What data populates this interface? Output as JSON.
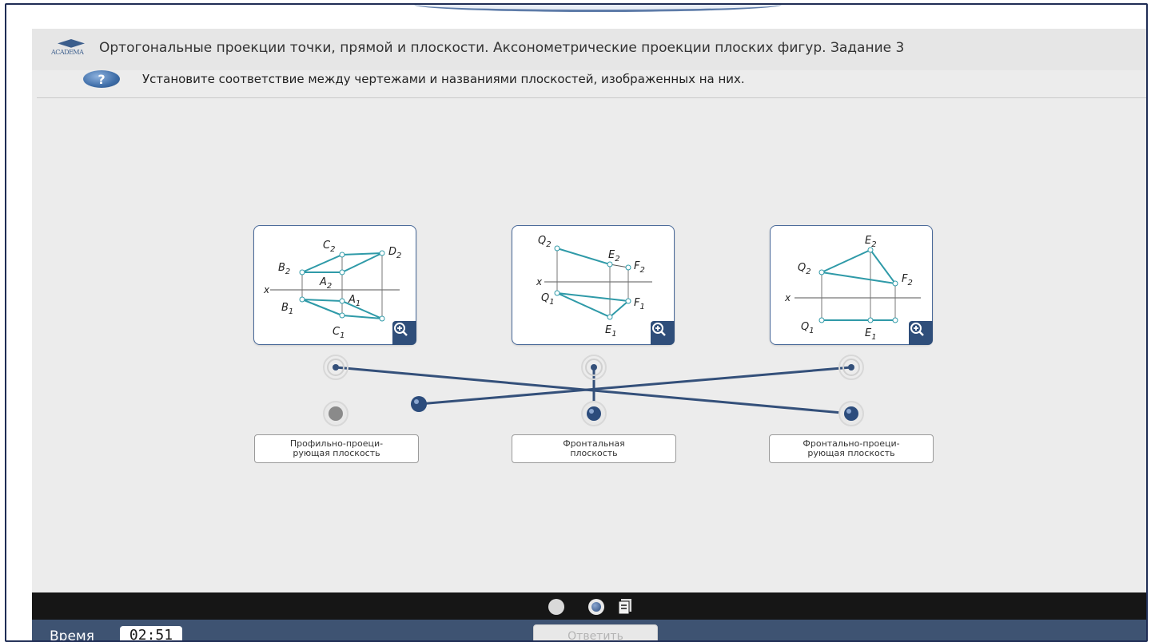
{
  "header": {
    "logo_text": "ACADEMA",
    "title": "Ортогональные проекции точки, прямой и плоскости. Аксонометрические проекции плоских фигур. Задание 3"
  },
  "question": {
    "icon": "question-icon",
    "text": "Установите соответствие между чертежами и названиями плоскостей, изображенных на них."
  },
  "drawings": [
    {
      "x_label": "x",
      "points": {
        "C2": "C2",
        "D2": "D2",
        "B2": "B2",
        "A2": "A2",
        "A1": "A1",
        "B1": "B1",
        "C1": "C1"
      },
      "zoom_icon": "zoom-in-icon"
    },
    {
      "x_label": "x",
      "points": {
        "Q2": "Q2",
        "E2": "E2",
        "F2": "F2",
        "Q1": "Q1",
        "F1": "F1",
        "E1": "E1"
      },
      "zoom_icon": "zoom-in-icon"
    },
    {
      "x_label": "x",
      "points": {
        "E2": "E2",
        "Q2": "Q2",
        "F2": "F2",
        "Q1": "Q1",
        "E1": "E1"
      },
      "zoom_icon": "zoom-in-icon"
    }
  ],
  "answers": [
    {
      "label": "Профильно-проеци-\nрующая плоскость"
    },
    {
      "label": "Фронтальная\nплоскость"
    },
    {
      "label": "Фронтально-проеци-\nрующая плоскость"
    }
  ],
  "connections": [
    {
      "drawing": 1,
      "answer": 3
    },
    {
      "drawing": 2,
      "answer": 2
    },
    {
      "drawing": 3,
      "answer": 1
    }
  ],
  "nav": {
    "pages": [
      "page-dot-1",
      "page-dot-2-current"
    ],
    "doc_icon": "document-icon"
  },
  "status": {
    "time_label": "Время",
    "time_value": "02:51",
    "answer_button": "Ответить"
  },
  "colors": {
    "accent": "#2f9aa8",
    "connector": "#34507a",
    "status_bar": "#3e5372",
    "nav_bar": "#161616"
  }
}
